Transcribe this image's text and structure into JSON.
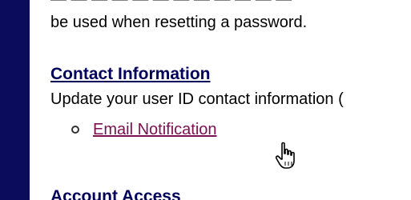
{
  "content": {
    "cut_line": "— — — — — — — — — — — —",
    "intro_text": "be used when resetting a password.",
    "contact_section": {
      "title": "Contact Information",
      "description": "Update your user ID contact information (",
      "link_label": "Email Notification"
    },
    "account_section": {
      "title": "Account Access"
    }
  },
  "colors": {
    "left_bar": "#0c0c5c",
    "section_title": "#00005a",
    "visited_link": "#7a1050"
  },
  "icons": [
    "bullet-circle-icon",
    "hand-pointer-icon"
  ]
}
